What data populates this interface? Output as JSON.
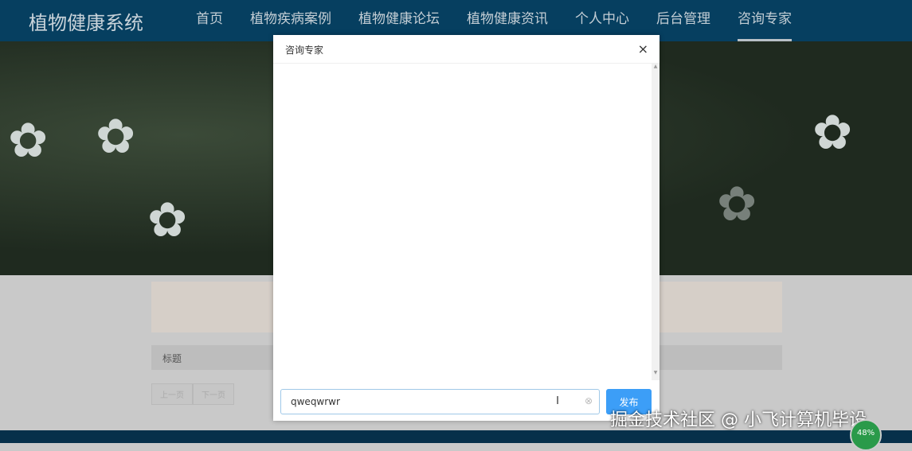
{
  "nav": {
    "logo": "植物健康系统",
    "items": [
      "首页",
      "植物疾病案例",
      "植物健康论坛",
      "植物健康资讯",
      "个人中心",
      "后台管理",
      "咨询专家"
    ],
    "active": 6
  },
  "content": {
    "title_label": "标题",
    "prev": "上一页",
    "next": "下一页"
  },
  "modal": {
    "title": "咨询专家",
    "close_icon": "×",
    "input_value": "qweqwrwr",
    "send": "发布"
  },
  "watermark": "掘金技术社区 @ 小飞计算机毕设",
  "badge": "48%"
}
